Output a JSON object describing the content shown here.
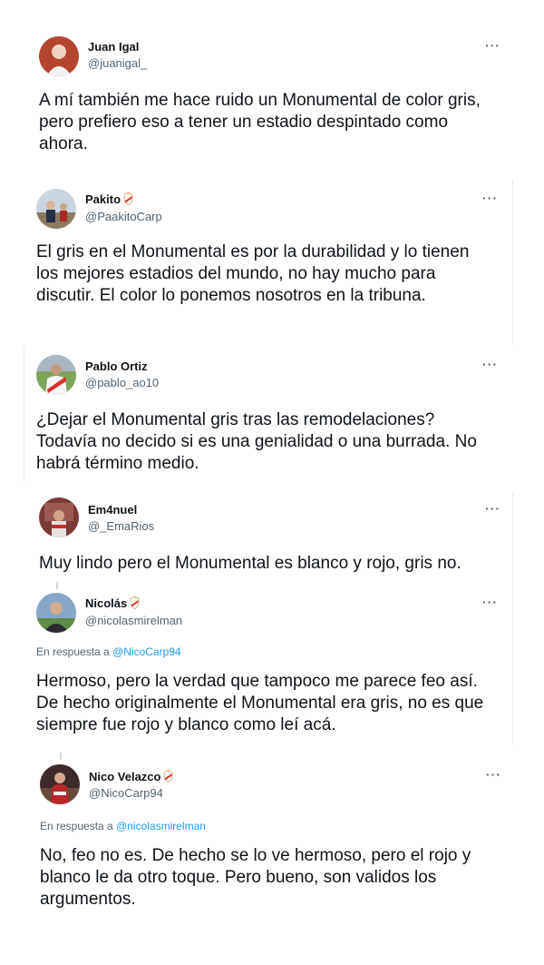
{
  "colors": {
    "accent": "#1d9bf0",
    "text": "#0f1419",
    "secondary": "#536471",
    "border": "#e6ecf0"
  },
  "tweets": [
    {
      "name": "Juan Igal",
      "handle": "@juanigal_",
      "more_icon": "more-horizontal-icon",
      "text": "A mí también me hace ruido un Monumental de color gris, pero prefiero eso a tener un estadio despintado como ahora."
    },
    {
      "name": "Pakito",
      "handle": "@PaakitoCarp",
      "badge_icon": "club-crest-icon",
      "more_icon": "more-horizontal-icon",
      "text": "El gris en el Monumental es por la durabilidad y lo tienen los mejores estadios del mundo, no hay mucho para discutir. El color lo ponemos nosotros en la tribuna."
    },
    {
      "name": "Pablo Ortiz",
      "handle": "@pablo_ao10",
      "more_icon": "more-horizontal-icon",
      "text": "¿Dejar el Monumental gris tras las remodelaciones? Todavía no decido si es una genialidad o una burrada. No habrá término medio."
    },
    {
      "name": "Em4nuel",
      "handle": "@_EmaRios",
      "more_icon": "more-horizontal-icon",
      "text": "Muy lindo pero el Monumental es blanco y rojo, gris no."
    },
    {
      "name": "Nicolás",
      "handle": "@nicolasmirelman",
      "badge_icon": "club-crest-icon",
      "more_icon": "more-horizontal-icon",
      "reply_prefix": "En respuesta a",
      "reply_to": "@NicoCarp94",
      "text": "Hermoso, pero la verdad que tampoco me parece feo así. De hecho originalmente el Monumental era gris, no es que siempre fue rojo y blanco como leí acá."
    },
    {
      "name": "Nico Velazco",
      "handle": "@NicoCarp94",
      "badge_icon": "club-crest-icon",
      "more_icon": "more-horizontal-icon",
      "reply_prefix": "En respuesta a",
      "reply_to": "@nicolasmirelman",
      "text": "No, feo no es. De hecho se lo ve hermoso, pero el rojo y blanco le da otro toque. Pero bueno, son validos los argumentos."
    }
  ]
}
